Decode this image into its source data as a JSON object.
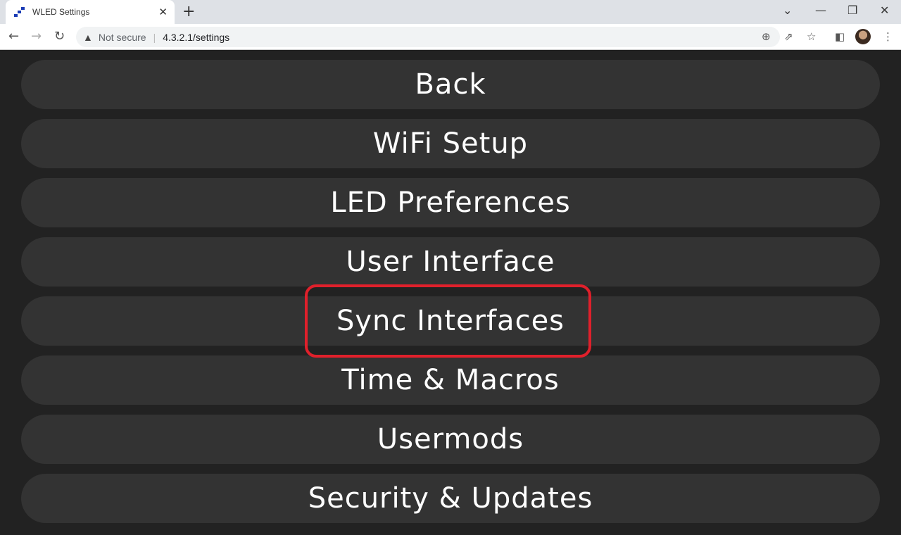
{
  "browser": {
    "tab_title": "WLED Settings",
    "security_label": "Not secure",
    "url": "4.3.2.1/settings",
    "icons": [
      "wled-favicon",
      "close-icon",
      "plus-icon",
      "chevron-down-icon",
      "minimize-icon",
      "restore-icon",
      "close-window-icon",
      "back-icon",
      "forward-icon",
      "reload-icon",
      "warning-icon",
      "zoom-icon",
      "share-icon",
      "star-icon",
      "sidebar-icon",
      "avatar",
      "kebab-menu-icon"
    ]
  },
  "menu": {
    "items": [
      {
        "label": "Back"
      },
      {
        "label": "WiFi Setup"
      },
      {
        "label": "LED Preferences"
      },
      {
        "label": "User Interface"
      },
      {
        "label": "Sync Interfaces",
        "highlighted": true
      },
      {
        "label": "Time & Macros"
      },
      {
        "label": "Usermods"
      },
      {
        "label": "Security & Updates"
      }
    ],
    "highlight_color": "#e0202b"
  }
}
